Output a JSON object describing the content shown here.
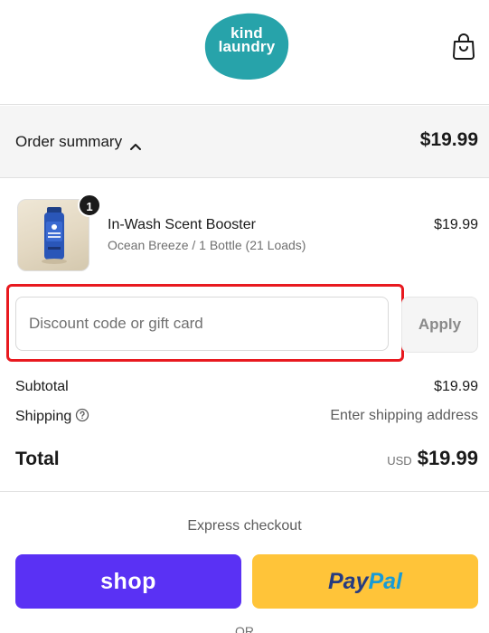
{
  "header": {
    "logo_text": "kind laundry",
    "logo_line1": "kind",
    "logo_line2": "laundry",
    "brand_color": "#27a3aa",
    "cart_icon": "shopping-bag-icon"
  },
  "summary": {
    "toggle_label": "Order summary",
    "toggle_icon": "chevron-up-icon",
    "total": "$19.99"
  },
  "line_item": {
    "name": "In-Wash Scent Booster",
    "variant": "Ocean Breeze / 1 Bottle (21 Loads)",
    "price": "$19.99",
    "quantity": "1"
  },
  "discount": {
    "placeholder": "Discount code or gift card",
    "value": "",
    "apply_label": "Apply",
    "highlight_color": "#e8191f"
  },
  "totals": {
    "subtotal_label": "Subtotal",
    "subtotal_value": "$19.99",
    "shipping_label": "Shipping",
    "shipping_value": "Enter shipping address",
    "total_label": "Total",
    "currency": "USD",
    "total_value": "$19.99"
  },
  "express": {
    "title": "Express checkout",
    "shop_label": "shop",
    "shop_color": "#5a31f4",
    "paypal_part1": "Pay",
    "paypal_part2": "Pal",
    "paypal_color": "#ffc439",
    "or_label": "OR"
  }
}
